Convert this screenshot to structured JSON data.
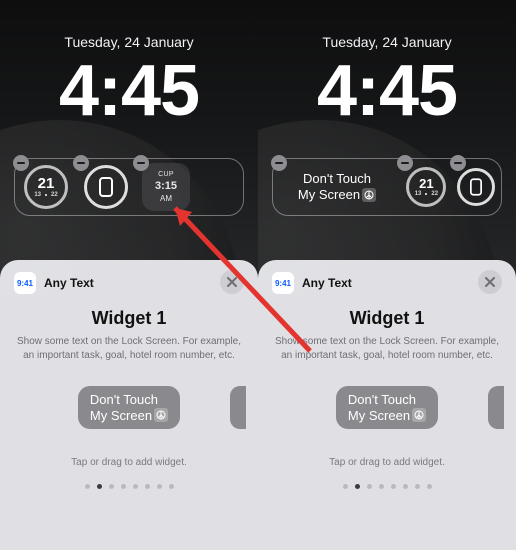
{
  "date": "Tuesday, 24 January",
  "time": "4:45",
  "left": {
    "widgets": {
      "weather": {
        "temp": "21",
        "low": "13",
        "high": "22"
      },
      "cup": {
        "label": "CUP",
        "time": "3:15",
        "ampm": "AM"
      }
    }
  },
  "right": {
    "widgets": {
      "text": {
        "line1": "Don't Touch",
        "line2": "My Screen"
      },
      "weather": {
        "temp": "21",
        "low": "13",
        "high": "22"
      }
    }
  },
  "sheet": {
    "app_icon_time": "9:41",
    "app_name": "Any Text",
    "title": "Widget 1",
    "desc": "Show some text on the Lock Screen. For example, an important task, goal, hotel room number, etc.",
    "preview": {
      "line1": "Don't Touch",
      "line2": "My Screen"
    },
    "hint": "Tap or drag to add widget.",
    "page_count": 8,
    "active_page": 1
  }
}
